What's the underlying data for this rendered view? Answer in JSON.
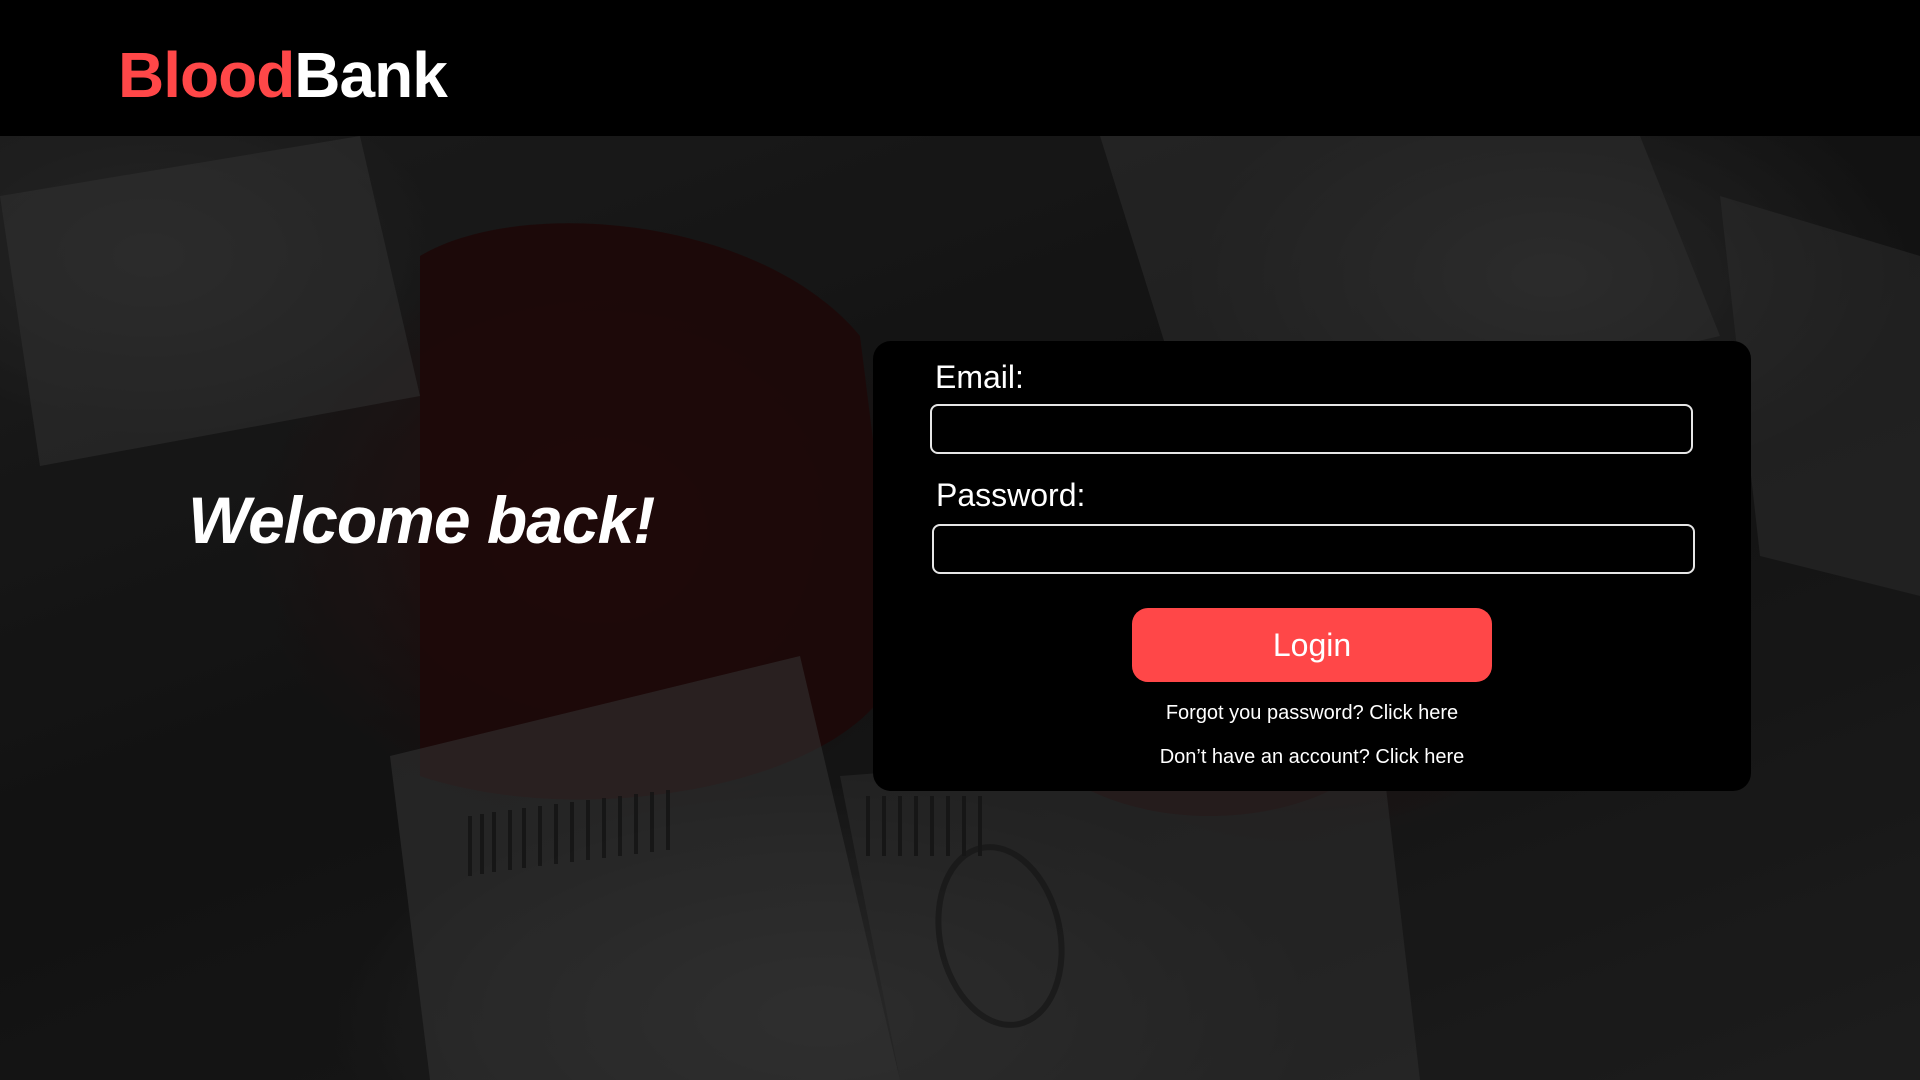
{
  "header": {
    "logo_part1": "Blood",
    "logo_part2": "Bank",
    "logo_accent_color": "#ff4748"
  },
  "hero": {
    "welcome_text": "Welcome back!"
  },
  "login_form": {
    "email_label": "Email:",
    "email_value": "",
    "password_label": "Password:",
    "password_value": "",
    "login_button_label": "Login",
    "login_button_color": "#ff4748",
    "forgot_password_link": "Forgot you password? Click here",
    "signup_link": "Don’t have an account? Click here"
  },
  "background": {
    "description_icon": "blood-bag-photo"
  }
}
